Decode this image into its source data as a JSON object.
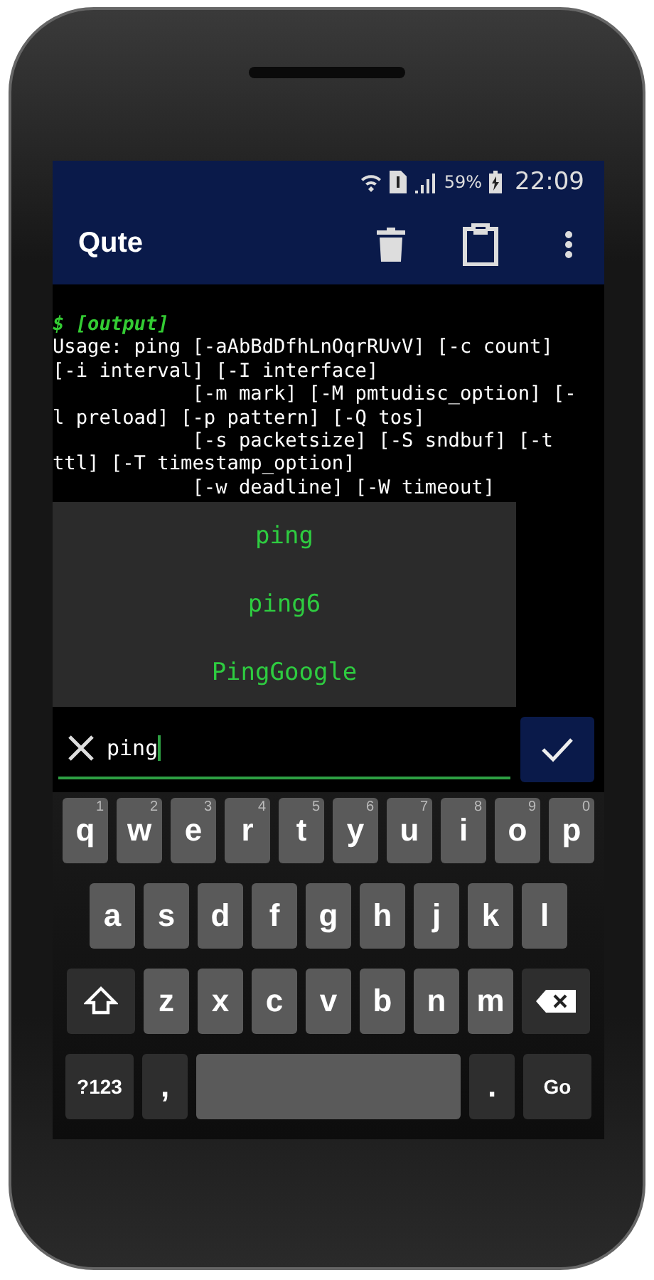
{
  "status_bar": {
    "battery": "59%",
    "time": "22:09"
  },
  "app_bar": {
    "title": "Qute"
  },
  "terminal": {
    "prompt": "$ [output]",
    "lines": [
      "Usage: ping [-aAbBdDfhLnOqrRUvV] [-c count]",
      "[-i interval] [-I interface]",
      "            [-m mark] [-M pmtudisc_option] [-",
      "l preload] [-p pattern] [-Q tos]",
      "            [-s packetsize] [-S sndbuf] [-t",
      "ttl] [-T timestamp_option]",
      "            [-w deadline] [-W timeout]"
    ]
  },
  "suggestions": [
    {
      "label": "ping"
    },
    {
      "label": "ping6"
    },
    {
      "label": "PingGoogle"
    }
  ],
  "command_input": {
    "value": "ping"
  },
  "keyboard": {
    "rows": [
      {
        "keys": [
          {
            "kind": "letter",
            "label": "q",
            "hint": "1"
          },
          {
            "kind": "letter",
            "label": "w",
            "hint": "2"
          },
          {
            "kind": "letter",
            "label": "e",
            "hint": "3"
          },
          {
            "kind": "letter",
            "label": "r",
            "hint": "4"
          },
          {
            "kind": "letter",
            "label": "t",
            "hint": "5"
          },
          {
            "kind": "letter",
            "label": "y",
            "hint": "6"
          },
          {
            "kind": "letter",
            "label": "u",
            "hint": "7"
          },
          {
            "kind": "letter",
            "label": "i",
            "hint": "8"
          },
          {
            "kind": "letter",
            "label": "o",
            "hint": "9"
          },
          {
            "kind": "letter",
            "label": "p",
            "hint": "0"
          }
        ]
      },
      {
        "keys": [
          {
            "kind": "letter",
            "label": "a"
          },
          {
            "kind": "letter",
            "label": "s"
          },
          {
            "kind": "letter",
            "label": "d"
          },
          {
            "kind": "letter",
            "label": "f"
          },
          {
            "kind": "letter",
            "label": "g"
          },
          {
            "kind": "letter",
            "label": "h"
          },
          {
            "kind": "letter",
            "label": "j"
          },
          {
            "kind": "letter",
            "label": "k"
          },
          {
            "kind": "letter",
            "label": "l"
          }
        ]
      },
      {
        "keys": [
          {
            "kind": "shift"
          },
          {
            "kind": "letter",
            "label": "z"
          },
          {
            "kind": "letter",
            "label": "x"
          },
          {
            "kind": "letter",
            "label": "c"
          },
          {
            "kind": "letter",
            "label": "v"
          },
          {
            "kind": "letter",
            "label": "b"
          },
          {
            "kind": "letter",
            "label": "n"
          },
          {
            "kind": "letter",
            "label": "m"
          },
          {
            "kind": "backspace"
          }
        ]
      },
      {
        "keys": [
          {
            "kind": "function",
            "label": "?123"
          },
          {
            "kind": "punct",
            "label": ","
          },
          {
            "kind": "space"
          },
          {
            "kind": "punct",
            "label": "."
          },
          {
            "kind": "function",
            "label": "Go"
          }
        ]
      }
    ]
  }
}
